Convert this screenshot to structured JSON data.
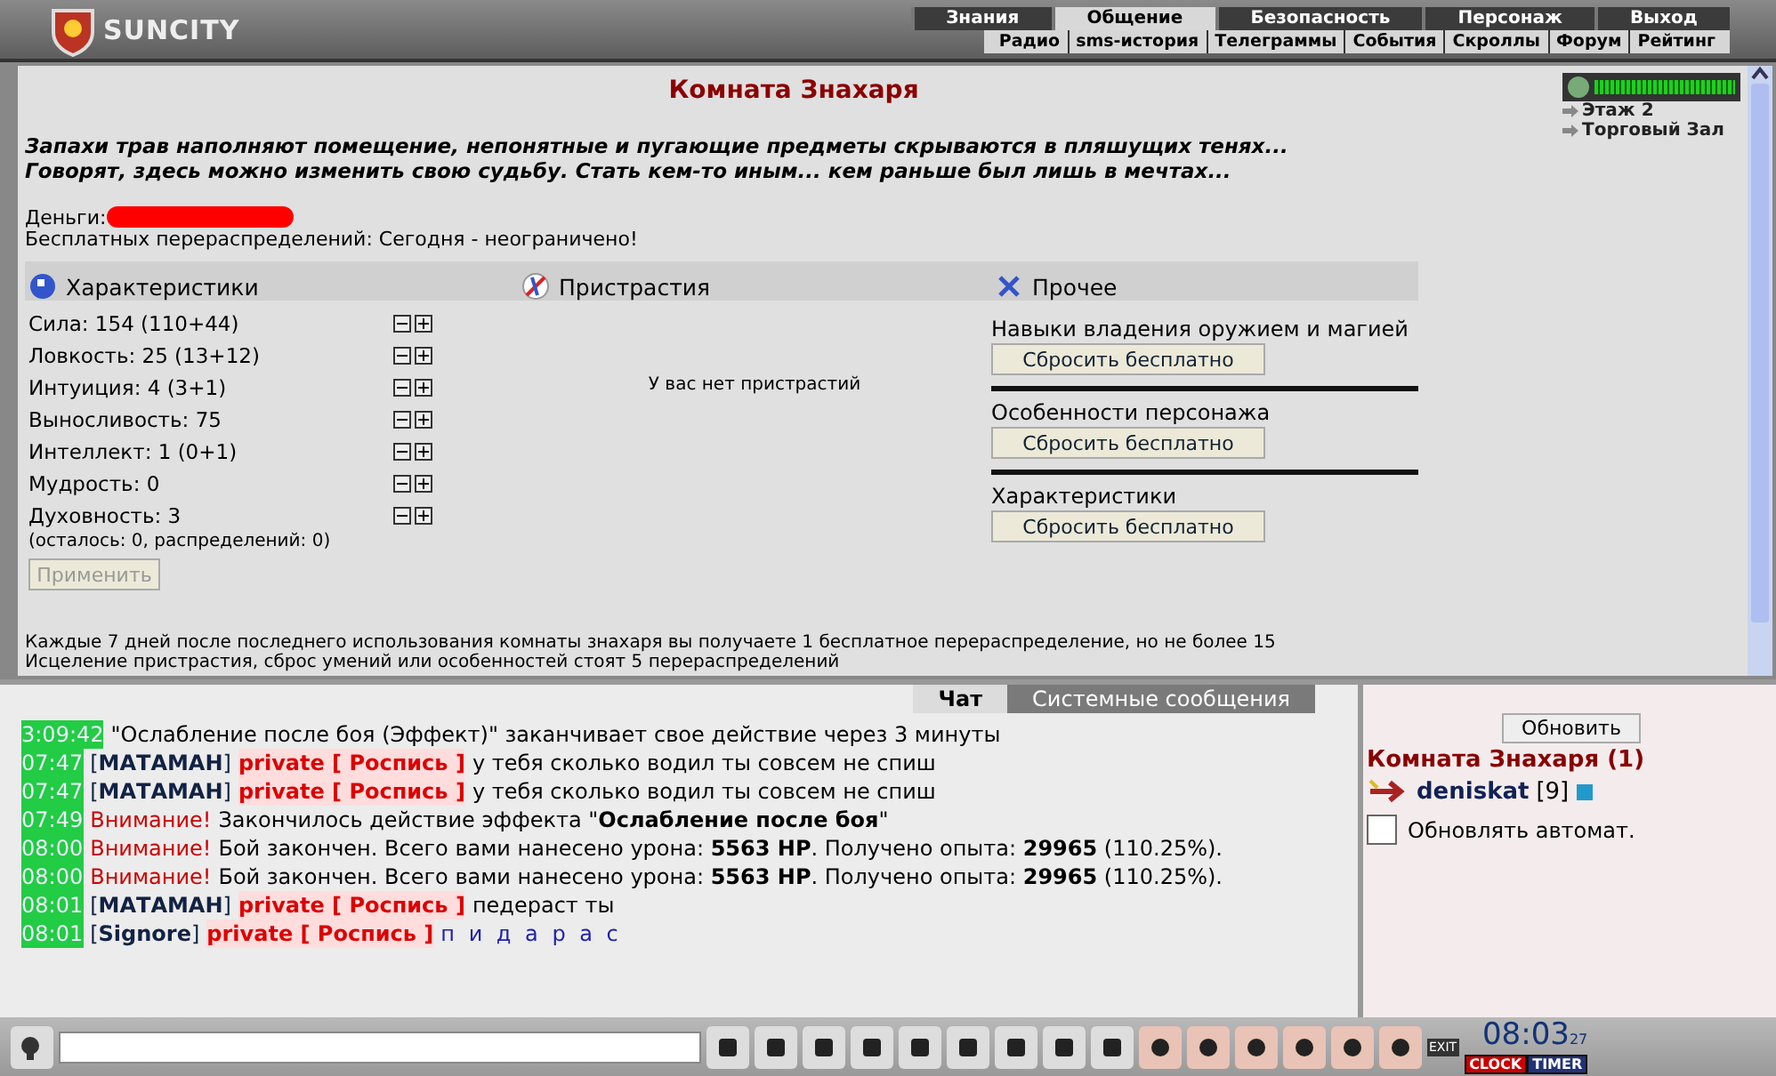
{
  "header": {
    "logo": "SUNCITY",
    "main_menu": [
      {
        "label": "Знания",
        "selected": false
      },
      {
        "label": "Общение",
        "selected": true
      },
      {
        "label": "Безопасность",
        "selected": false
      },
      {
        "label": "Персонаж",
        "selected": false
      },
      {
        "label": "Выход",
        "selected": false
      }
    ],
    "sub_menu": [
      "Радио",
      "sms-история",
      "Телеграммы",
      "События",
      "Скроллы",
      "Форум",
      "Рейтинг"
    ]
  },
  "room": {
    "title": "Комната Знахаря",
    "description": [
      "Запахи трав наполняют помещение, непонятные и пугающие предметы скрываются в пляшущих тенях...",
      "Говорят, здесь можно изменить свою судьбу. Стать кем-то иным... кем раньше был лишь в мечтах..."
    ],
    "money_label": "Деньги:",
    "free_redistributions": "Бесплатных перераспределений: Сегодня - неограничено!",
    "location": {
      "level": 1,
      "links": [
        "Этаж 2",
        "Торговый Зал"
      ]
    },
    "stats_header": "Характеристики",
    "stats": [
      "Сила: 154 (110+44)",
      "Ловкость: 25 (13+12)",
      "Интуиция: 4 (3+1)",
      "Выносливость: 75",
      "Интеллект: 1 (0+1)",
      "Мудрость: 0",
      "Духовность: 3"
    ],
    "stats_remaining": "(осталось: 0, распределений: 0)",
    "apply_button": {
      "label": "Применить",
      "disabled": true
    },
    "addictions_header": "Пристрастия",
    "addictions_empty": "У вас нет пристрастий",
    "other_header": "Прочее",
    "resets": [
      {
        "label": "Навыки владения оружием и магией",
        "button": "Сбросить бесплатно"
      },
      {
        "label": "Особенности персонажа",
        "button": "Сбросить бесплатно"
      },
      {
        "label": "Характеристики",
        "button": "Сбросить бесплатно"
      }
    ],
    "notes": [
      "Каждые 7 дней после последнего использования комнаты знахаря вы получаете 1 бесплатное перераспределение, но не более 15",
      "Исцеление пристрастия, сброс умений или особенностей стоят 5 перераспределений"
    ]
  },
  "chat": {
    "tabs": [
      {
        "label": "Чат",
        "selected": true
      },
      {
        "label": "Системные сообщения",
        "selected": false
      }
    ],
    "messages": [
      {
        "time": "3:09:42",
        "kind": "system",
        "text": "\"Ослабление после боя (Эффект)\" заканчивает свое действие через 3 минуты"
      },
      {
        "time": "07:47",
        "kind": "private",
        "sender": "[**МАТАМАН**]",
        "tag": "private [ Роспись ]",
        "text": "у тебя сколько водил ты совсем не спиш",
        "spaced": false
      },
      {
        "time": "07:47",
        "kind": "private",
        "sender": "[**МАТАМАН**]",
        "tag": "private [ Роспись ]",
        "text": "у тебя сколько водил ты совсем не спиш",
        "spaced": false
      },
      {
        "time": "07:49",
        "kind": "warning",
        "label": "Внимание!",
        "text": "Закончилось действие эффекта \"**Ослабление после боя**\""
      },
      {
        "time": "08:00",
        "kind": "warning",
        "label": "Внимание!",
        "text": "Бой закончен. Всего вами нанесено урона: **5563 HP**. Получено опыта: **29965** (110.25%)."
      },
      {
        "time": "08:00",
        "kind": "warning",
        "label": "Внимание!",
        "text": "Бой закончен. Всего вами нанесено урона: **5563 HP**. Получено опыта: **29965** (110.25%)."
      },
      {
        "time": "08:01",
        "kind": "private",
        "sender": "[**МАТАМАН**]",
        "tag": "private [ Роспись ]",
        "text": "педераст ты",
        "spaced": false
      },
      {
        "time": "08:01",
        "kind": "private",
        "sender": "[**Signore**]",
        "tag": "private [ Роспись ]",
        "text": "п и д а р а с",
        "spaced": true
      }
    ]
  },
  "online": {
    "refresh_button": "Обновить",
    "room_title": "Комната Знахаря (1)",
    "users": [
      {
        "name": "deniskat",
        "level": "[9]"
      }
    ],
    "auto_refresh": {
      "label": "Обновлять автомат.",
      "checked": false
    }
  },
  "toolbar": {
    "clock": "08:03",
    "clock_seconds": "27",
    "clock_tabs": [
      {
        "label": "CLOCK",
        "selected": true
      },
      {
        "label": "TIMER",
        "selected": false
      }
    ],
    "exit_label": "EXIT"
  }
}
